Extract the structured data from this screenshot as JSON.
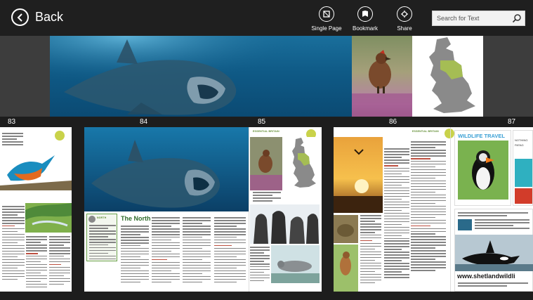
{
  "appbar": {
    "back_label": "Back",
    "commands": [
      {
        "label": "Single Page",
        "icon": "single-page-icon"
      },
      {
        "label": "Bookmark",
        "icon": "bookmark-icon"
      },
      {
        "label": "Share",
        "icon": "share-icon"
      }
    ],
    "search_placeholder": "Search for Text"
  },
  "page_numbers": [
    "83",
    "84",
    "85",
    "86",
    "87"
  ],
  "spread1": {
    "region_tag": "NORTH",
    "title": "The North",
    "section_tag": "ESSENTIAL BRITAIN"
  },
  "spread2": {
    "section_tag": "ESSENTIAL BRITAIN",
    "ad_title": "WILDLIFE TRAVEL",
    "ad_side": "NOTHING PATAG",
    "ad_url": "www.shetlandwildli"
  },
  "colors": {
    "appbar": "#1f1f1f",
    "background": "#1d1d1d",
    "accent_green": "#2e6b2a"
  }
}
